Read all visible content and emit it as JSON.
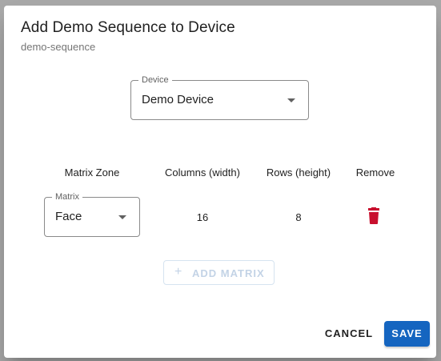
{
  "dialog": {
    "title": "Add Demo Sequence to Device",
    "subtitle": "demo-sequence"
  },
  "device_select": {
    "label": "Device",
    "value": "Demo Device",
    "icon": "chevron-down-icon"
  },
  "table": {
    "headers": {
      "matrix_zone": "Matrix Zone",
      "columns": "Columns (width)",
      "rows": "Rows (height)",
      "remove": "Remove"
    },
    "rows": [
      {
        "matrix_label": "Matrix",
        "matrix_value": "Face",
        "columns": "16",
        "rows": "8",
        "delete_icon": "trash-icon"
      }
    ]
  },
  "add_matrix": {
    "icon": "+",
    "label": "ADD MATRIX"
  },
  "actions": {
    "cancel": "CANCEL",
    "save": "SAVE"
  },
  "colors": {
    "primary": "#1565c0",
    "delete": "#c8102e",
    "disabled": "#c3d3e6"
  }
}
